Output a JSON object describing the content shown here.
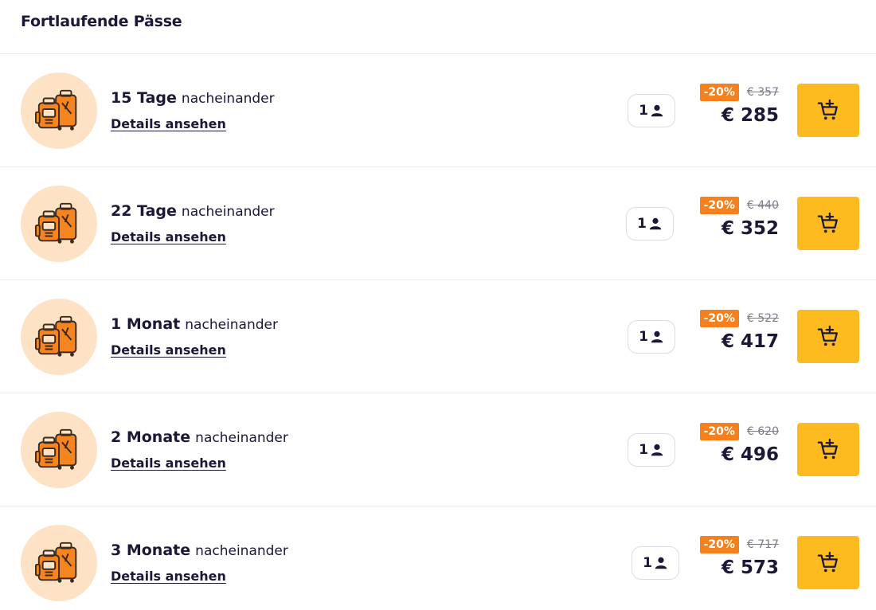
{
  "header": {
    "title": "Fortlaufende Pässe"
  },
  "colors": {
    "accent_cart": "#fdbb1f",
    "discount_badge": "#f77f1c",
    "thumb_bg": "#fde2c6",
    "text_dark": "#1b1838"
  },
  "icons": {
    "thumbnail": "luggage-icon",
    "person": "person-icon",
    "cart": "cart-add-icon"
  },
  "passes": [
    {
      "duration": "15 Tage",
      "suffix": "nacheinander",
      "details_label": "Details ansehen",
      "persons": "1",
      "discount": "-20%",
      "old_price": "€ 357",
      "price": "€ 285"
    },
    {
      "duration": "22 Tage",
      "suffix": "nacheinander",
      "details_label": "Details ansehen",
      "persons": "1",
      "discount": "-20%",
      "old_price": "€ 440",
      "price": "€ 352"
    },
    {
      "duration": "1 Monat",
      "suffix": "nacheinander",
      "details_label": "Details ansehen",
      "persons": "1",
      "discount": "-20%",
      "old_price": "€ 522",
      "price": "€ 417"
    },
    {
      "duration": "2 Monate",
      "suffix": "nacheinander",
      "details_label": "Details ansehen",
      "persons": "1",
      "discount": "-20%",
      "old_price": "€ 620",
      "price": "€ 496"
    },
    {
      "duration": "3 Monate",
      "suffix": "nacheinander",
      "details_label": "Details ansehen",
      "persons": "1",
      "discount": "-20%",
      "old_price": "€ 717",
      "price": "€ 573"
    }
  ]
}
